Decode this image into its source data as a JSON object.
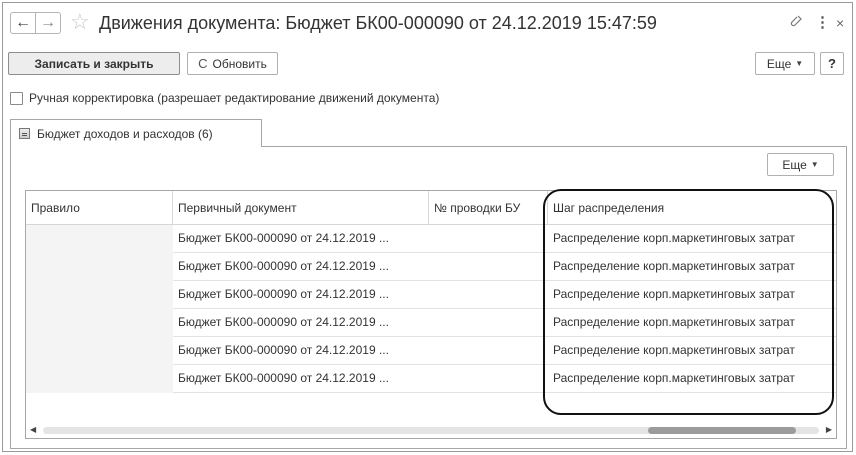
{
  "window": {
    "back_glyph": "←",
    "forward_glyph": "→",
    "star_glyph": "☆",
    "title": "Движения документа: Бюджет БК00-000090 от 24.12.2019 15:47:59",
    "link_glyph": "🔗",
    "more_glyph": "⋮",
    "close_glyph": "×"
  },
  "toolbar": {
    "save_close_label": "Записать и закрыть",
    "refresh_label": "Обновить",
    "refresh_glyph": "C",
    "more_label": "Еще",
    "help_label": "?"
  },
  "manual_edit": {
    "label": "Ручная корректировка (разрешает редактирование движений документа)",
    "checked": false
  },
  "tab": {
    "label": "Бюджет доходов и расходов (6)"
  },
  "table": {
    "more_label": "Еще",
    "columns": [
      "Правило",
      "Первичный документ",
      "№ проводки БУ",
      "Шаг распределения"
    ],
    "rows": [
      [
        "",
        "Бюджет БК00-000090 от 24.12.2019 ...",
        "",
        "Распределение корп.маркетинговых затрат"
      ],
      [
        "",
        "Бюджет БК00-000090 от 24.12.2019 ...",
        "",
        "Распределение корп.маркетинговых затрат"
      ],
      [
        "",
        "Бюджет БК00-000090 от 24.12.2019 ...",
        "",
        "Распределение корп.маркетинговых затрат"
      ],
      [
        "",
        "Бюджет БК00-000090 от 24.12.2019 ...",
        "",
        "Распределение корп.маркетинговых затрат"
      ],
      [
        "",
        "Бюджет БК00-000090 от 24.12.2019 ...",
        "",
        "Распределение корп.маркетинговых затрат"
      ],
      [
        "",
        "Бюджет БК00-000090 от 24.12.2019 ...",
        "",
        "Распределение корп.маркетинговых затрат"
      ]
    ]
  }
}
